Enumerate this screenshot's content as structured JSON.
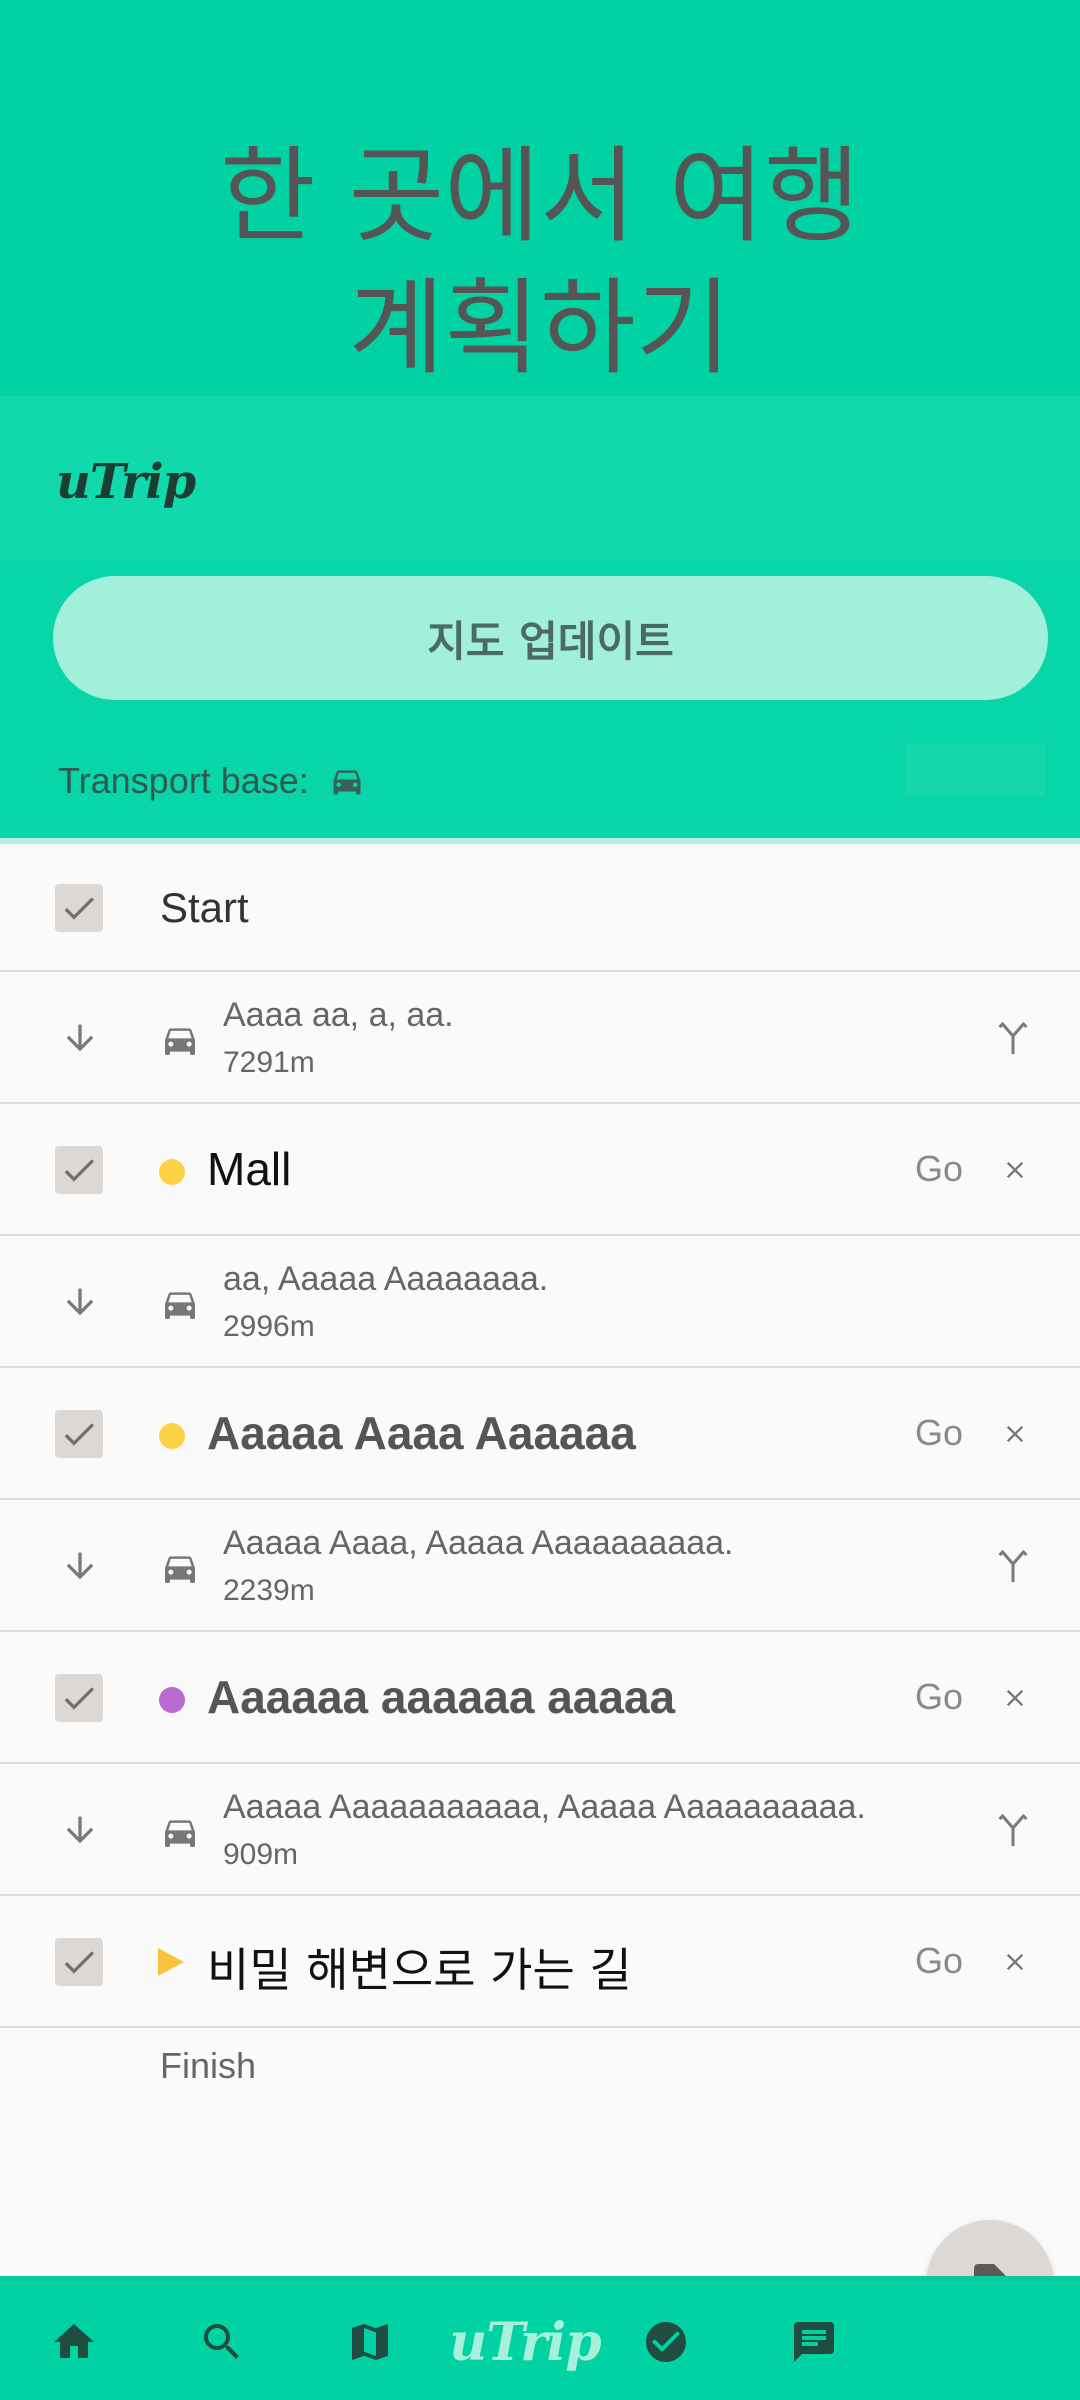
{
  "hero": {
    "title_line1": "한 곳에서 여행",
    "title_line2": "계획하기"
  },
  "panel": {
    "logo": "uTrip",
    "update_button": "지도 업데이트",
    "transport_label": "Transport base:",
    "transport_icon": "car-icon"
  },
  "route": {
    "start_label": "Start",
    "finish_label": "Finish",
    "go_label": "Go",
    "stops": [
      {
        "name": "Mall",
        "marker": "dot",
        "color": "#fdd245",
        "bold": false,
        "checked": true
      },
      {
        "name": "Aaaaa Aaaa Aaaaaa",
        "marker": "dot",
        "color": "#fdd245",
        "bold": true,
        "checked": true
      },
      {
        "name": "Aaaaaa aaaaaa aaaaa",
        "marker": "dot",
        "color": "#b96bcf",
        "bold": true,
        "checked": true
      },
      {
        "name": "비밀 해변으로 가는 길",
        "marker": "triangle",
        "color": "#f9c23c",
        "bold": false,
        "checked": true
      }
    ],
    "legs": [
      {
        "desc": "Aaaa aa, a, aa.",
        "distance": "7291m",
        "alt_route": true
      },
      {
        "desc": "aa, Aaaaa Aaaaaaaa.",
        "distance": "2996m",
        "alt_route": false
      },
      {
        "desc": "Aaaaa Aaaa, Aaaaa Aaaaaaaaaa.",
        "distance": "2239m",
        "alt_route": true
      },
      {
        "desc": "Aaaaa Aaaaaaaaaaa, Aaaaa Aaaaaaaaaa.",
        "distance": "909m",
        "alt_route": true
      }
    ]
  },
  "bottom_nav": {
    "items": [
      "home-icon",
      "search-icon",
      "map-icon",
      "utrip-logo",
      "check-circle-icon",
      "chat-icon"
    ],
    "logo": "uTrip"
  },
  "colors": {
    "brand": "#00d2a3",
    "button": "#a2efdc",
    "checkbox": "#ddd8d3"
  }
}
